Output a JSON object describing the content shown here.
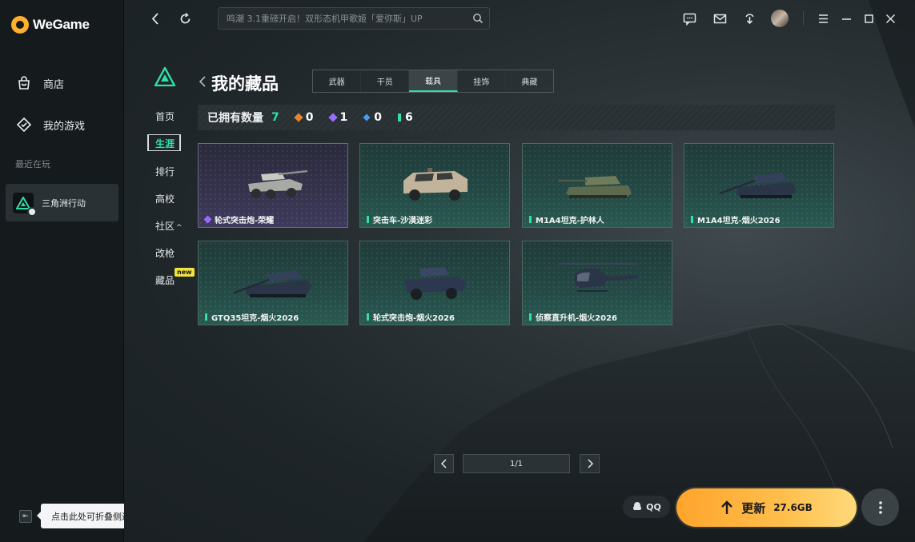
{
  "app": {
    "logo_text": "WeGame"
  },
  "sidebar": {
    "items": [
      {
        "label": "商店",
        "icon": "store-icon"
      },
      {
        "label": "我的游戏",
        "icon": "my-games-icon"
      }
    ],
    "recent_label": "最近在玩",
    "recent_game": {
      "name": "三角洲行动",
      "icon": "delta-force-icon"
    },
    "collapse_tooltip": "点击此处可折叠侧边栏"
  },
  "topbar": {
    "search_placeholder": "鸣潮 3.1重磅开启！双形态机甲歌姬「爱弥斯」UP",
    "icons": [
      "back-icon",
      "refresh-icon",
      "search-icon",
      "feedback-icon",
      "mail-icon",
      "download-icon",
      "avatar",
      "menu-icon",
      "minimize-icon",
      "maximize-icon",
      "close-icon"
    ]
  },
  "game_nav": {
    "items": [
      {
        "label": "首页",
        "active": false
      },
      {
        "label": "生涯",
        "active": true
      },
      {
        "label": "排行",
        "active": false
      },
      {
        "label": "高校",
        "active": false
      },
      {
        "label": "社区",
        "suffix": "^",
        "active": false
      },
      {
        "label": "改枪",
        "active": false
      },
      {
        "label": "藏品",
        "badge": "new",
        "active": false
      }
    ]
  },
  "collection": {
    "title": "我的藏品",
    "tabs": [
      {
        "label": "武器",
        "active": false
      },
      {
        "label": "干员",
        "active": false
      },
      {
        "label": "载具",
        "active": true
      },
      {
        "label": "挂饰",
        "active": false
      },
      {
        "label": "典藏",
        "active": false
      }
    ],
    "owned_label": "已拥有数量",
    "owned_count": "7",
    "rarity_counts": [
      {
        "color": "#e8822b",
        "value": "0"
      },
      {
        "color": "#9a6bff",
        "value": "1"
      },
      {
        "color": "#4a9ce8",
        "value": "0"
      },
      {
        "color": "#2fe0a4",
        "value": "6"
      }
    ],
    "cards": [
      {
        "name": "轮式突击炮-荣耀",
        "rarity": "purple",
        "vehicle": "wheeled-assault-gun"
      },
      {
        "name": "突击车-沙漠迷彩",
        "rarity": "green",
        "vehicle": "assault-vehicle"
      },
      {
        "name": "M1A4坦克-护林人",
        "rarity": "green",
        "vehicle": "tank"
      },
      {
        "name": "M1A4坦克-烟火2026",
        "rarity": "green",
        "vehicle": "tank"
      },
      {
        "name": "GTQ35坦克-烟火2026",
        "rarity": "green",
        "vehicle": "tank"
      },
      {
        "name": "轮式突击炮-烟火2026",
        "rarity": "green",
        "vehicle": "wheeled-assault-gun"
      },
      {
        "name": "侦察直升机-烟火2026",
        "rarity": "green",
        "vehicle": "helicopter"
      }
    ],
    "pagination": "1/1"
  },
  "actions": {
    "qq_label": "QQ",
    "update_label": "更新",
    "update_size": "27.6GB"
  }
}
